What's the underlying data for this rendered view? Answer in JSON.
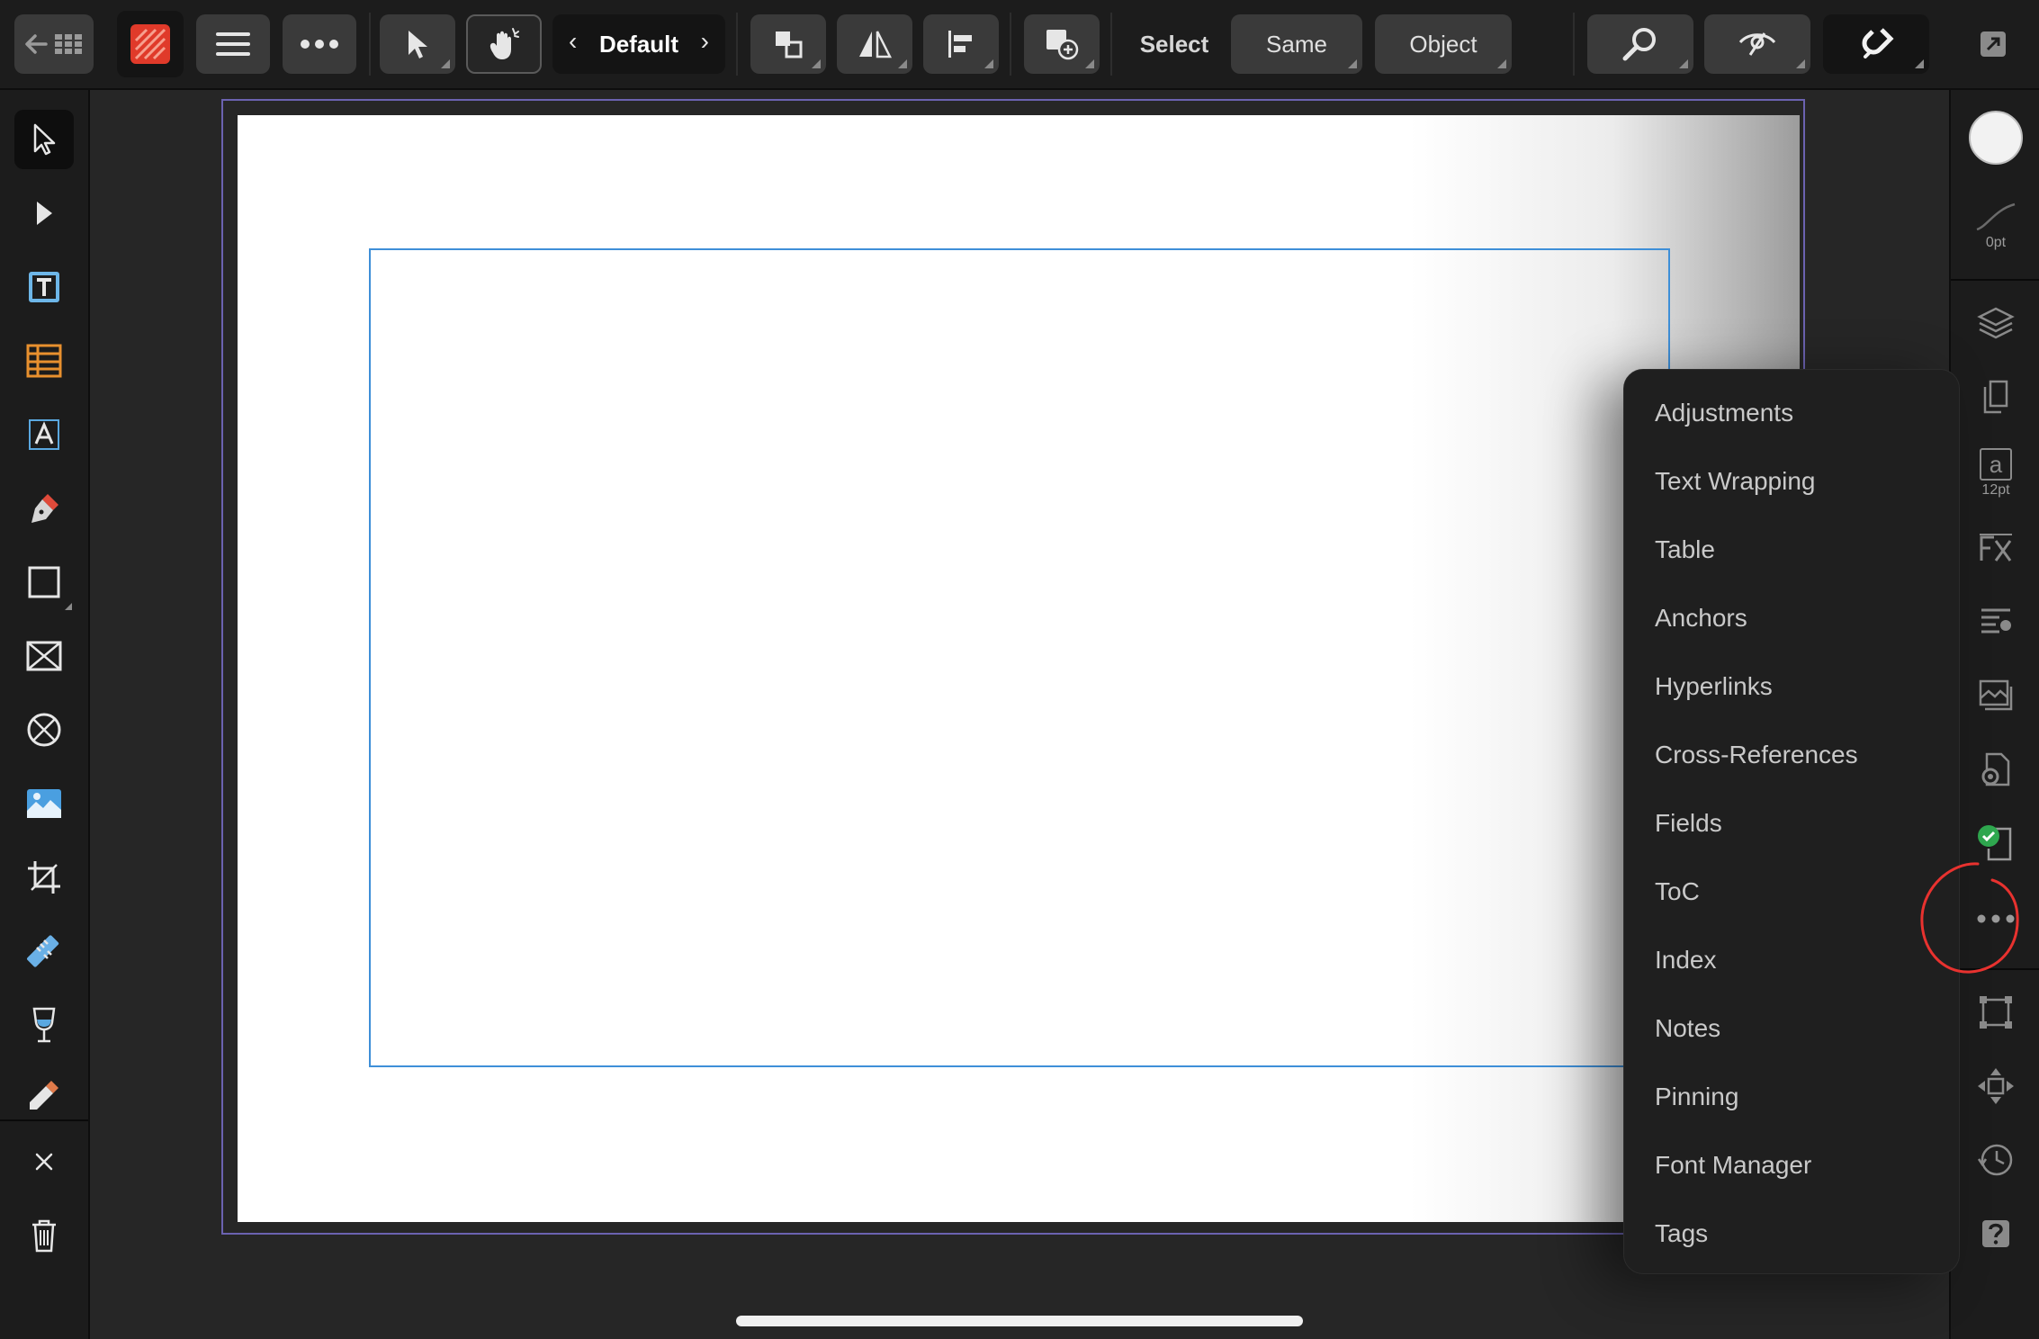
{
  "toolbar": {
    "preset": "Default",
    "select_label": "Select",
    "same_label": "Same",
    "object_label": "Object"
  },
  "stroke": {
    "width_label": "0pt"
  },
  "text_style": {
    "size_label": "12pt",
    "glyph": "a"
  },
  "studio_menu": {
    "items": [
      "Adjustments",
      "Text Wrapping",
      "Table",
      "Anchors",
      "Hyperlinks",
      "Cross-References",
      "Fields",
      "ToC",
      "Index",
      "Notes",
      "Pinning",
      "Font Manager",
      "Tags"
    ]
  },
  "colors": {
    "accent": "#3e8fd8",
    "page_outline": "#6b62b0",
    "annotation": "#e8322f",
    "app_icon": "#e03a2a",
    "ok_check": "#2fa84f"
  }
}
